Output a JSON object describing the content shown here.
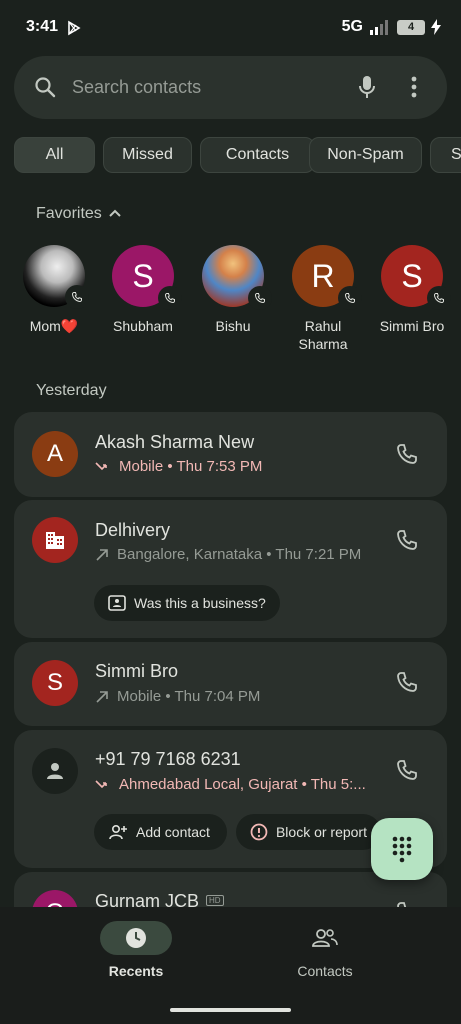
{
  "status_bar": {
    "time": "3:41",
    "network": "5G",
    "battery": "4"
  },
  "search": {
    "placeholder": "Search contacts"
  },
  "filters": [
    "All",
    "Missed",
    "Contacts",
    "Non-Spam",
    "S"
  ],
  "favorites": {
    "label": "Favorites",
    "items": [
      {
        "name": "Mom❤️",
        "initial": "",
        "color": "#000000"
      },
      {
        "name": "Shubham",
        "initial": "S",
        "color": "#9b1767"
      },
      {
        "name": "Bishu",
        "initial": "",
        "color": "#b5463a"
      },
      {
        "name": "Rahul Sharma",
        "initial": "R",
        "color": "#8a3c12"
      },
      {
        "name": "Simmi Bro",
        "initial": "S",
        "color": "#a3251f"
      }
    ]
  },
  "recents": {
    "group_label": "Yesterday",
    "calls": [
      {
        "name": "Akash Sharma New",
        "initial": "A",
        "color": "#8a3c12",
        "detail": "Mobile • Thu 7:53 PM",
        "type": "missed"
      },
      {
        "name": "Delhivery",
        "initial": "",
        "color": "#a3251f",
        "detail": "Bangalore, Karnataka • Thu 7:21 PM",
        "type": "outgoing",
        "action": "Was this a business?"
      },
      {
        "name": "Simmi Bro",
        "initial": "S",
        "color": "#a3251f",
        "detail": "Mobile • Thu 7:04 PM",
        "type": "outgoing"
      },
      {
        "name": "+91 79 7168 6231",
        "initial": "",
        "color": "#3a403b",
        "detail": "Ahmedabad Local, Gujarat • Thu 5:...",
        "type": "missed",
        "actions": [
          "Add contact",
          "Block or report"
        ]
      },
      {
        "name": "Gurnam JCB",
        "initial": "G",
        "color": "#9b1767",
        "badge": "HD"
      }
    ]
  },
  "bottom_nav": {
    "recents": "Recents",
    "contacts": "Contacts"
  },
  "colors": {
    "missed": "#f2b8b5",
    "fab": "#b5e3c2",
    "active_nav": "#3b4a3f"
  }
}
